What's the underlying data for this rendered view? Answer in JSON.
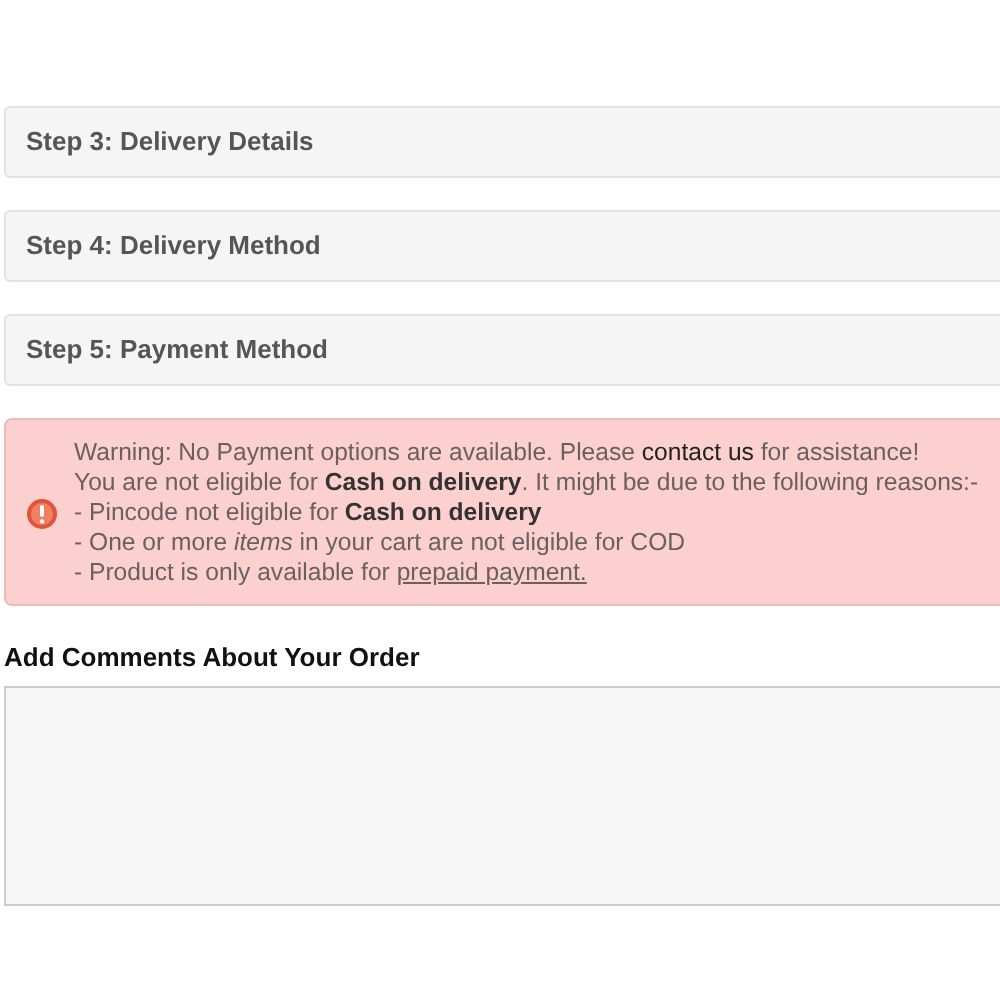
{
  "steps": [
    {
      "title": "Step 3: Delivery Details"
    },
    {
      "title": "Step 4: Delivery Method"
    },
    {
      "title": "Step 5: Payment Method"
    }
  ],
  "alert": {
    "lines": [
      {
        "kind": "link",
        "before": "Warning: No Payment options are available. Please ",
        "link": "contact us",
        "after": " for assistance!"
      },
      {
        "kind": "text",
        "text": "You are not eligible for **Cash on delivery**. It might be due to the following reasons:-"
      },
      {
        "kind": "text",
        "text": "- Pincode not eligible for **Cash on delivery**"
      },
      {
        "kind": "text",
        "text": "- One or more *items* in your cart are not eligible for COD"
      },
      {
        "kind": "link",
        "before": "- Product is only available for ",
        "link": "prepaid payment."
      }
    ]
  },
  "comments": {
    "label": "Add Comments About Your Order"
  }
}
